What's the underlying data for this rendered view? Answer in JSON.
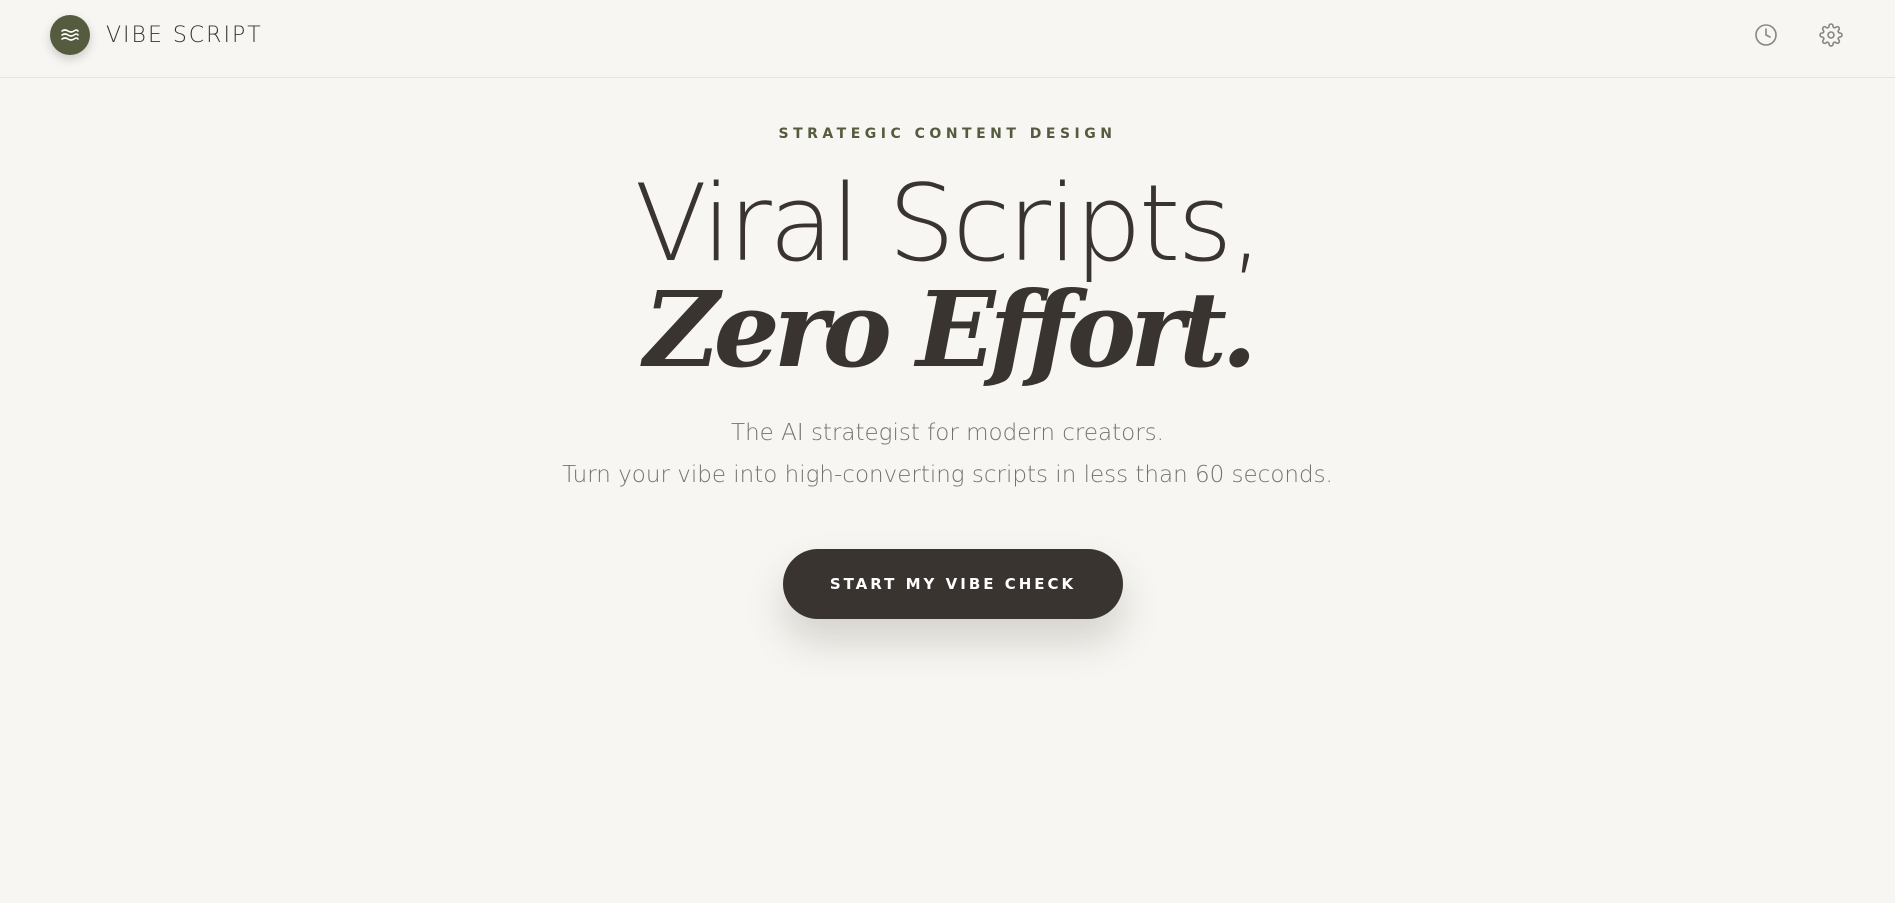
{
  "header": {
    "brand_name": "VIBE SCRIPT",
    "logo_icon": "waves-icon",
    "history_icon": "clock-icon",
    "settings_icon": "gear-icon"
  },
  "hero": {
    "eyebrow": "STRATEGIC CONTENT DESIGN",
    "headline_line1": "Viral Scripts,",
    "headline_line2": "Zero Effort.",
    "subtitle_line1": "The AI strategist for modern creators.",
    "subtitle_line2": "Turn your vibe into high-converting scripts in less than 60 seconds.",
    "cta_label": "START MY VIBE CHECK"
  },
  "colors": {
    "background": "#f7f6f2",
    "accent_olive": "#545b3e",
    "text_dark": "#3a3431",
    "text_muted": "#77716c",
    "button_bg": "#3a3431",
    "button_text": "#ffffff"
  }
}
